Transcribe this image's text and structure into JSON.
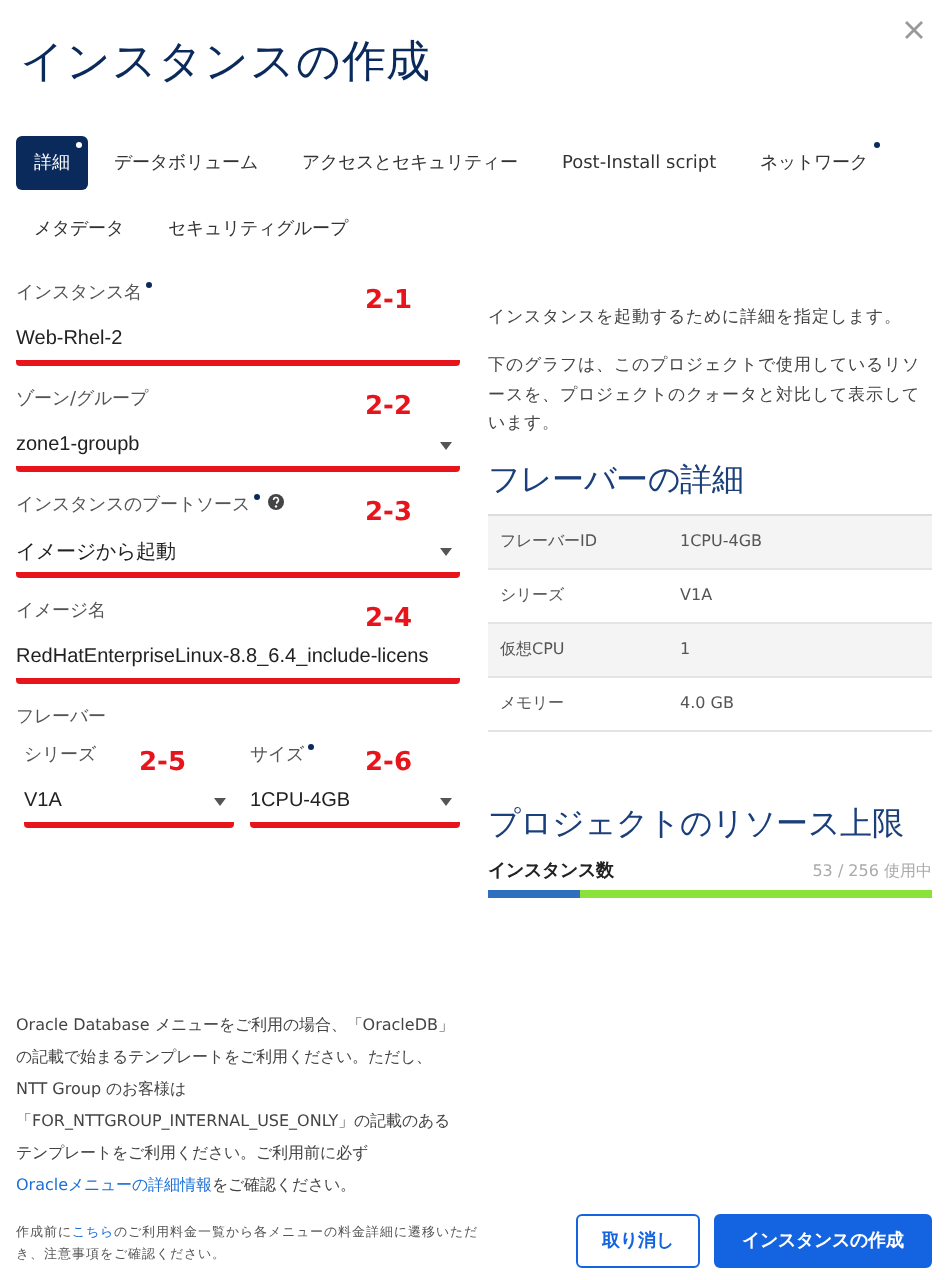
{
  "title": "インスタンスの作成",
  "tabs": [
    {
      "label": "詳細",
      "selected": true,
      "required": true
    },
    {
      "label": "データボリューム",
      "selected": false,
      "required": false
    },
    {
      "label": "アクセスとセキュリティー",
      "selected": false,
      "required": false
    },
    {
      "label": "Post-Install script",
      "selected": false,
      "required": false
    },
    {
      "label": "ネットワーク",
      "selected": false,
      "required": true
    },
    {
      "label": "メタデータ",
      "selected": false,
      "required": false
    },
    {
      "label": "セキュリティグループ",
      "selected": false,
      "required": false
    }
  ],
  "fields": [
    {
      "label": "インスタンス名",
      "required": true,
      "help": false,
      "kind": "text",
      "value": "Web-Rhel-2",
      "annotation": "2-1"
    },
    {
      "label": "ゾーン/グループ",
      "required": false,
      "help": false,
      "kind": "select",
      "value": "zone1-groupb",
      "annotation": "2-2"
    },
    {
      "label": "インスタンスのブートソース",
      "required": true,
      "help": true,
      "kind": "select",
      "value": "イメージから起動",
      "annotation": "2-3"
    },
    {
      "label": "イメージ名",
      "required": false,
      "help": false,
      "kind": "text",
      "value": "RedHatEnterpriseLinux-8.8_6.4_include-licens",
      "annotation": "2-4"
    }
  ],
  "flavor": {
    "label": "フレーバー",
    "fields": [
      {
        "label": "シリーズ",
        "required": false,
        "help": false,
        "kind": "select",
        "value": "V1A",
        "annotation": "2-5"
      },
      {
        "label": "サイズ",
        "required": true,
        "help": false,
        "kind": "select",
        "value": "1CPU-4GB",
        "annotation": "2-6"
      }
    ]
  },
  "intro": [
    "インスタンスを起動するために詳細を指定します。",
    "下のグラフは、このプロジェクトで使用しているリソースを、プロジェクトのクォータと対比して表示しています。"
  ],
  "flavor_details": {
    "title": "フレーバーの詳細",
    "rows": [
      {
        "label": "フレーバーID",
        "value": "1CPU-4GB"
      },
      {
        "label": "シリーズ",
        "value": "V1A"
      },
      {
        "label": "仮想CPU",
        "value": "1"
      },
      {
        "label": "メモリー",
        "value": "4.0 GB"
      }
    ]
  },
  "limits": {
    "title": "プロジェクトのリソース上限",
    "items": [
      {
        "label": "インスタンス数",
        "reading": "53 / 256 使用中",
        "level": 0.207
      }
    ]
  },
  "note": {
    "text": "Oracle Database メニューをご利用の場合、「OracleDB」の記載で始まるテンプレートをご利用ください。ただし、NTT Group のお客様は「FOR_NTTGROUP_INTERNAL_USE_ONLY」の記載のあるテンプレートをご利用ください。ご利用前に必ず",
    "link": "Oracleメニューの詳細情報",
    "after": "をご確認ください。"
  },
  "footer": {
    "before": "作成前に",
    "link": "こちら",
    "after": "のご利用料金一覧から各メニューの料金詳細に遷移いただき、注意事項をご確認ください。"
  },
  "buttons": [
    {
      "label": "取り消し",
      "kind": "secondary"
    },
    {
      "label": "インスタンスの作成",
      "kind": "primary"
    }
  ]
}
